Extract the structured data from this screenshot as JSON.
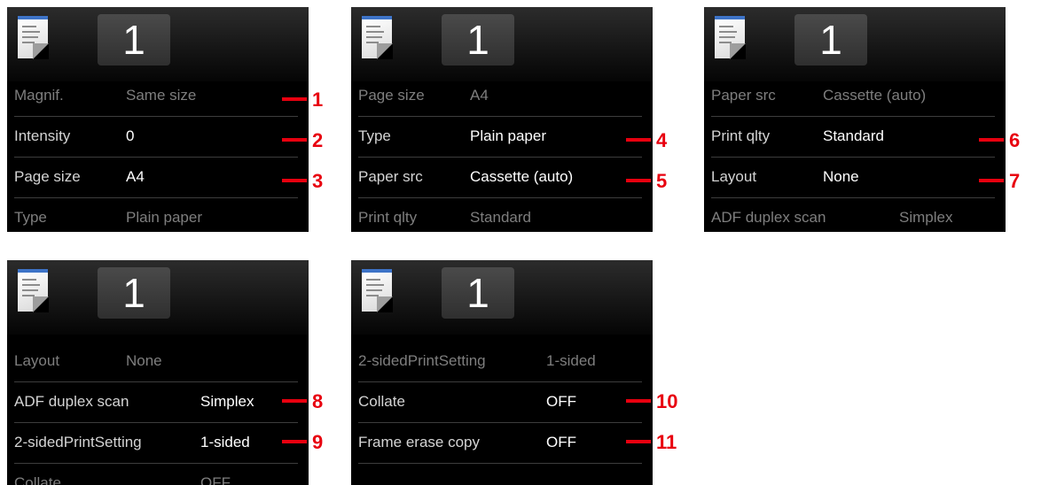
{
  "callout_color": "#e8000f",
  "screens": [
    {
      "count": "1",
      "rows": [
        {
          "label": "Magnif.",
          "value": "Same size"
        },
        {
          "label": "Intensity",
          "value": "0"
        },
        {
          "label": "Page size",
          "value": "A4"
        },
        {
          "label": "Type",
          "value": "Plain paper"
        }
      ]
    },
    {
      "count": "1",
      "rows": [
        {
          "label": "Page size",
          "value": "A4"
        },
        {
          "label": "Type",
          "value": "Plain paper"
        },
        {
          "label": "Paper src",
          "value": "Cassette (auto)"
        },
        {
          "label": "Print qlty",
          "value": "Standard"
        }
      ]
    },
    {
      "count": "1",
      "rows": [
        {
          "label": "Paper src",
          "value": "Cassette (auto)"
        },
        {
          "label": "Print qlty",
          "value": "Standard"
        },
        {
          "label": "Layout",
          "value": "None"
        },
        {
          "label": "ADF duplex scan",
          "value": "Simplex"
        }
      ]
    },
    {
      "count": "1",
      "rows": [
        {
          "label": "Layout",
          "value": "None"
        },
        {
          "label": "ADF duplex scan",
          "value": "Simplex"
        },
        {
          "label": "2-sidedPrintSetting",
          "value": "1-sided"
        },
        {
          "label": "Collate",
          "value": "OFF"
        }
      ]
    },
    {
      "count": "1",
      "rows": [
        {
          "label": "2-sidedPrintSetting",
          "value": "1-sided"
        },
        {
          "label": "Collate",
          "value": "OFF"
        },
        {
          "label": "Frame erase copy",
          "value": "OFF"
        }
      ]
    }
  ],
  "callouts": [
    "1",
    "2",
    "3",
    "4",
    "5",
    "6",
    "7",
    "8",
    "9",
    "10",
    "11"
  ]
}
